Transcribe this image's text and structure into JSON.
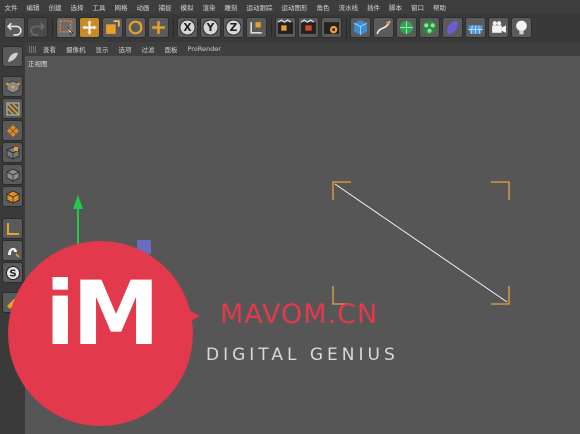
{
  "menu": [
    "文件",
    "编辑",
    "创建",
    "选择",
    "工具",
    "网格",
    "动画",
    "捕捉",
    "模拟",
    "渲染",
    "雕刻",
    "运动跟踪",
    "运动图形",
    "角色",
    "流水线",
    "插件",
    "脚本",
    "窗口",
    "帮助"
  ],
  "toolbar": {
    "tools": [
      "undo-icon",
      "redo-icon",
      "live-selection-icon",
      "move-icon",
      "scale-icon",
      "rotate-icon",
      "add-icon",
      "x-axis-icon",
      "y-axis-icon",
      "z-axis-icon",
      "coordinate-system-icon",
      "render-view-icon",
      "render-picture-viewer-icon",
      "render-settings-icon",
      "cube-icon",
      "pen-spline-icon",
      "subdivision-icon",
      "array-icon",
      "deformer-icon",
      "floor-icon",
      "camera-icon",
      "light-icon"
    ],
    "axis_labels": [
      "X",
      "Y",
      "Z"
    ]
  },
  "view_menu": [
    "查看",
    "摄像机",
    "显示",
    "选项",
    "过滤",
    "面板",
    "ProRender"
  ],
  "viewport": {
    "label": "正视图",
    "background": "#565656"
  },
  "sidebar": [
    "make-editable-icon",
    "points-mode-icon",
    "edges-mode-icon",
    "polygons-mode-icon",
    "model-mode-icon",
    "texture-mode-icon",
    "object-axis-icon",
    "workplane-icon",
    "snap-icon",
    "locked-workplane-icon",
    "tweak-icon"
  ],
  "watermark": {
    "logo": "iM",
    "brand": "MAVOM.CN",
    "tagline": "DIGITAL GENIUS",
    "accent": "#e3394d"
  },
  "colors": {
    "camera_frame": "#e8a33a",
    "y_axis": "#22c94a",
    "x_axis": "#e3394d"
  }
}
